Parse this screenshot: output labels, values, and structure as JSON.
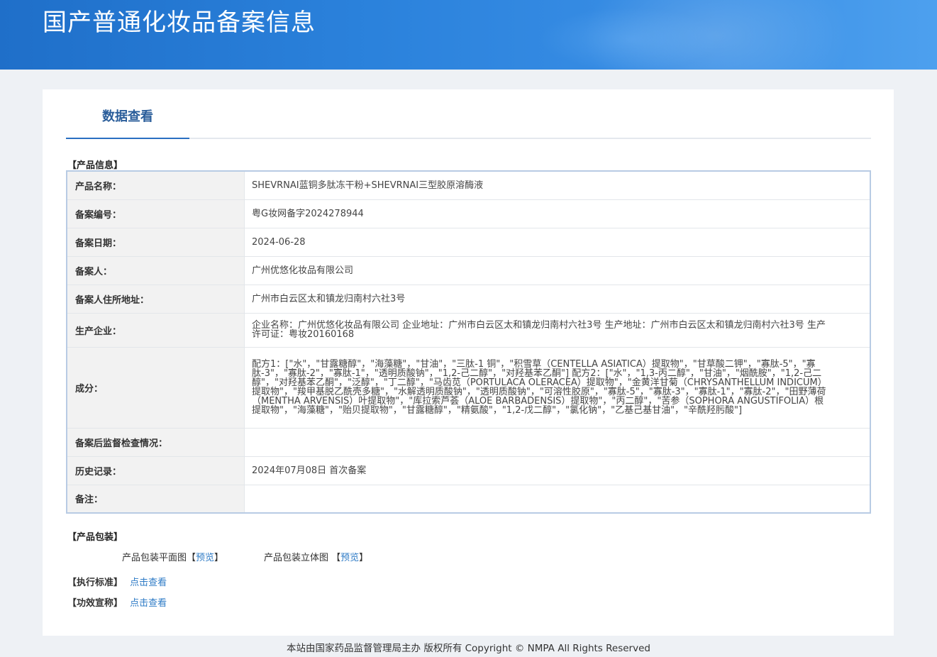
{
  "header": {
    "title": "国产普通化妆品备案信息"
  },
  "tabs": [
    {
      "label": "数据查看"
    }
  ],
  "product_info": {
    "section_label": "【产品信息】",
    "rows": [
      {
        "key": "产品名称：",
        "value": "SHEVRNAI蓝铜多肽冻干粉+SHEVRNAI三型胶原溶酶液"
      },
      {
        "key": "备案编号：",
        "value": "粤G妆网备字2024278944"
      },
      {
        "key": "备案日期：",
        "value": "2024-06-28"
      },
      {
        "key": "备案人：",
        "value": "广州优悠化妆品有限公司"
      },
      {
        "key": "备案人住所地址：",
        "value": "广州市白云区太和镇龙归南村六社3号"
      },
      {
        "key": "生产企业：",
        "value": "企业名称：广州优悠化妆品有限公司 企业地址：广州市白云区太和镇龙归南村六社3号 生产地址：广州市白云区太和镇龙归南村六社3号 生产许可证：粤妆20160168"
      },
      {
        "key": "成分：",
        "value": "配方1：[\"水\"，\"甘露糖醇\"，\"海藻糖\"，\"甘油\"，\"三肽-1 铜\"，\"积雪草（CENTELLA ASIATICA）提取物\"，\"甘草酸二钾\"，\"寡肽-5\"，\"寡肽-3\"，\"寡肽-2\"，\"寡肽-1\"，\"透明质酸钠\"，\"1,2-己二醇\"，\"对羟基苯乙酮\"] 配方2：[\"水\"，\"1,3-丙二醇\"，\"甘油\"，\"烟酰胺\"，\"1,2-己二醇\"，\"对羟基苯乙酮\"，\"泛醇\"，\"丁二醇\"，\"马齿苋（PORTULACA OLERACEA）提取物\"，\"金黄洋甘菊（CHRYSANTHELLUM INDICUM）提取物\"，\"羧甲基脱乙酰壳多糖\"，\"水解透明质酸钠\"，\"透明质酸钠\"，\"可溶性胶原\"，\"寡肽-5\"，\"寡肽-3\"，\"寡肽-1\"，\"寡肽-2\"，\"田野薄荷（MENTHA ARVENSIS）叶提取物\"，\"库拉索芦荟（ALOE BARBADENSIS）提取物\"，\"丙二醇\"，\"苦参（SOPHORA ANGUSTIFOLIA）根提取物\"，\"海藻糖\"，\"贻贝提取物\"，\"甘露糖醇\"，\"精氨酸\"，\"1,2-戊二醇\"，\"氯化钠\"，\"乙基己基甘油\"，\"辛酰羟肟酸\"]"
      },
      {
        "key": "备案后监督检查情况：",
        "value": ""
      },
      {
        "key": "历史记录：",
        "value": "2024年07月08日 首次备案"
      },
      {
        "key": "备注：",
        "value": ""
      }
    ]
  },
  "packaging": {
    "section_label": "【产品包装】",
    "flat_label": "产品包装平面图",
    "flat_link": "预览",
    "solid_label": "产品包装立体图",
    "solid_link": "预览"
  },
  "standard": {
    "section_label": "【执行标准】",
    "link": "点击查看"
  },
  "efficacy": {
    "section_label": "【功效宣称】",
    "link": "点击查看"
  },
  "footer": {
    "text": "本站由国家药品监督管理局主办 版权所有 Copyright © NMPA All Rights Reserved"
  }
}
